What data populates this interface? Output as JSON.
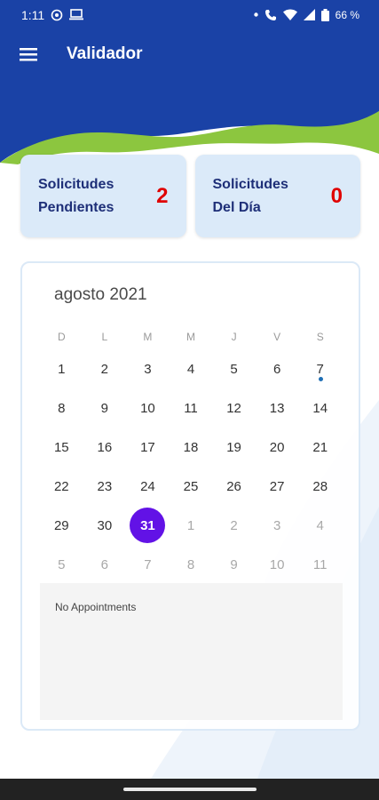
{
  "status_bar": {
    "time": "1:11",
    "battery": "66 %"
  },
  "app_bar": {
    "title": "Validador"
  },
  "cards": [
    {
      "label_line1": "Solicitudes",
      "label_line2": "Pendientes",
      "count": "2"
    },
    {
      "label_line1": "Solicitudes",
      "label_line2": "Del Día",
      "count": "0"
    }
  ],
  "calendar": {
    "month": "agosto 2021",
    "weekdays": [
      "D",
      "L",
      "M",
      "M",
      "J",
      "V",
      "S"
    ],
    "days": [
      {
        "n": "1"
      },
      {
        "n": "2"
      },
      {
        "n": "3"
      },
      {
        "n": "4"
      },
      {
        "n": "5"
      },
      {
        "n": "6"
      },
      {
        "n": "7",
        "event": true
      },
      {
        "n": "8"
      },
      {
        "n": "9"
      },
      {
        "n": "10"
      },
      {
        "n": "11"
      },
      {
        "n": "12"
      },
      {
        "n": "13"
      },
      {
        "n": "14"
      },
      {
        "n": "15"
      },
      {
        "n": "16"
      },
      {
        "n": "17"
      },
      {
        "n": "18"
      },
      {
        "n": "19"
      },
      {
        "n": "20"
      },
      {
        "n": "21"
      },
      {
        "n": "22"
      },
      {
        "n": "23"
      },
      {
        "n": "24"
      },
      {
        "n": "25"
      },
      {
        "n": "26"
      },
      {
        "n": "27"
      },
      {
        "n": "28"
      },
      {
        "n": "29"
      },
      {
        "n": "30"
      },
      {
        "n": "31",
        "selected": true
      },
      {
        "n": "1",
        "muted": true
      },
      {
        "n": "2",
        "muted": true
      },
      {
        "n": "3",
        "muted": true
      },
      {
        "n": "4",
        "muted": true
      },
      {
        "n": "5",
        "muted": true
      },
      {
        "n": "6",
        "muted": true
      },
      {
        "n": "7",
        "muted": true
      },
      {
        "n": "8",
        "muted": true
      },
      {
        "n": "9",
        "muted": true
      },
      {
        "n": "10",
        "muted": true
      },
      {
        "n": "11",
        "muted": true
      }
    ],
    "empty_message": "No Appointments"
  },
  "colors": {
    "header": "#1a42a6",
    "wave": "#8cc63f",
    "card": "#dbeaf9",
    "selected_day": "#6212e6",
    "count": "#e00000"
  },
  "icons": [
    "menu-icon",
    "whatsapp-icon",
    "laptop-icon",
    "wifi-icon",
    "signal-icon",
    "battery-icon",
    "event-dot"
  ]
}
